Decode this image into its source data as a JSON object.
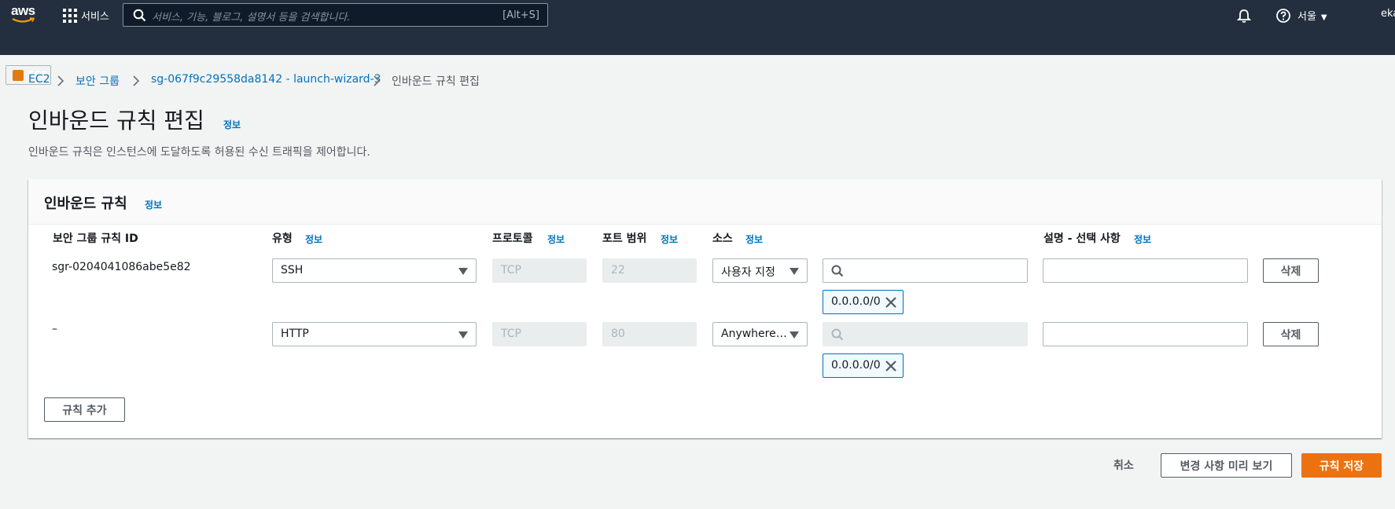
{
  "topnav": {
    "logo_text": "aws",
    "services_label": "서비스",
    "search_placeholder": "서비스, 기능, 블로그, 설명서 등을 검색합니다.",
    "search_shortcut": "[Alt+S]",
    "region": "서울",
    "user": "eka",
    "icons": [
      "grid-icon",
      "search-icon",
      "bell-icon",
      "help-icon",
      "caret-down-icon"
    ]
  },
  "subnav": {
    "service_pill": "EC2"
  },
  "breadcrumbs": [
    {
      "label": "EC2"
    },
    {
      "label": "보안 그룹"
    },
    {
      "label": "sg-067f9c29558da8142 - launch-wizard-3"
    },
    {
      "label": "인바운드 규칙 편집"
    }
  ],
  "page": {
    "title": "인바운드 규칙 편집",
    "info_link": "정보",
    "description": "인바운드 규칙은 인스턴스에 도달하도록 허용된 수신 트래픽을 제어합니다."
  },
  "panel": {
    "title": "인바운드 규칙",
    "info_link": "정보",
    "columns": {
      "rule_id": "보안 그룹 규칙 ID",
      "type": "유형",
      "protocol": "프로토콜",
      "port_range": "포트 범위",
      "source": "소스",
      "description": "설명 - 선택 사항",
      "info": "정보"
    },
    "rows": [
      {
        "rule_id": "sgr-0204041086abe5e82",
        "type": "SSH",
        "protocol": "TCP",
        "port": "22",
        "source_type": "사용자 지정",
        "source_search": "",
        "cidr": "0.0.0.0/0",
        "description": "",
        "delete_label": "삭제"
      },
      {
        "rule_id": "–",
        "type": "HTTP",
        "protocol": "TCP",
        "port": "80",
        "source_type": "Anywhere…",
        "source_search": "",
        "cidr": "0.0.0.0/0",
        "description": "",
        "delete_label": "삭제"
      }
    ],
    "add_rule_label": "규칙 추가"
  },
  "footer": {
    "cancel_label": "취소",
    "preview_label": "변경 사항 미리 보기",
    "save_label": "규칙 저장"
  },
  "colors": {
    "nav": "#232f3e",
    "link": "#0073bb",
    "primary": "#ec7211"
  }
}
